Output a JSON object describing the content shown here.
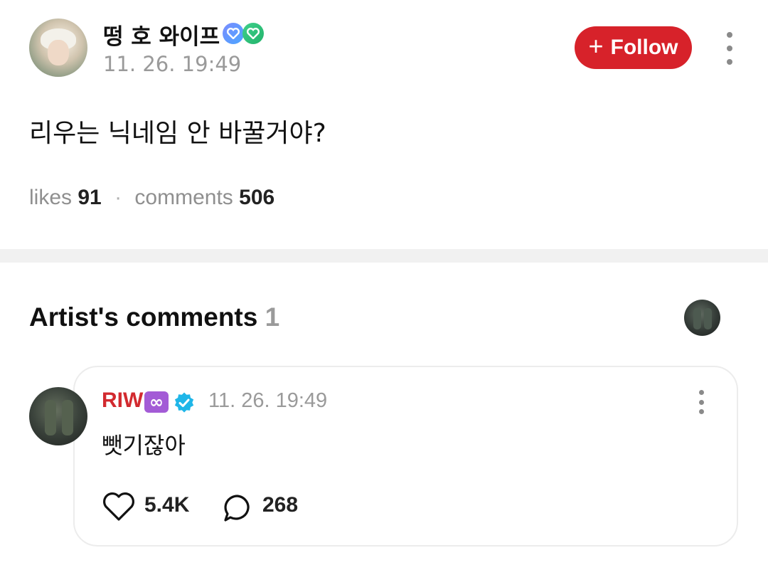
{
  "post": {
    "author_name": "떵 호 와이프",
    "timestamp": "11. 26. 19:49",
    "follow_label": "Follow",
    "body": "리우는 닉네임 안 바꿀거야?",
    "likes_label": "likes",
    "likes_count": "91",
    "comments_label": "comments",
    "comments_count": "506",
    "separator": "·"
  },
  "artist_comments": {
    "title": "Artist's comments",
    "count": "1",
    "comment": {
      "author": "RIW",
      "infinity_badge": "∞",
      "timestamp": "11. 26. 19:49",
      "body": "뺏기잖아",
      "like_count": "5.4K",
      "reply_count": "268"
    }
  },
  "colors": {
    "follow_button": "#d7222a",
    "artist_name": "#d22a2f",
    "verified": "#1fb6e8",
    "infinity_badge": "#a35bd6"
  },
  "icons": [
    "plus-icon",
    "more-vertical-icon",
    "verified-icon",
    "infinity-icon",
    "heart-icon",
    "comment-bubble-icon"
  ]
}
